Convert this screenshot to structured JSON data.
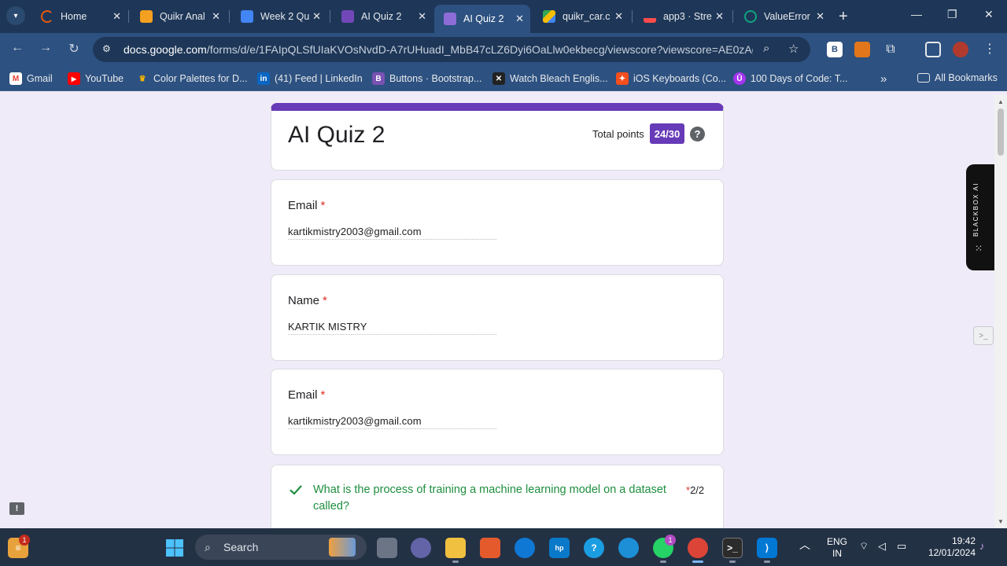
{
  "browser": {
    "tabs": [
      {
        "title": "Home",
        "color": "#e8590c",
        "active": false
      },
      {
        "title": "Quikr Anal",
        "color": "#f4a020",
        "active": false
      },
      {
        "title": "Week 2 Qu",
        "color": "#4285f4",
        "active": false
      },
      {
        "title": "AI Quiz 2",
        "color": "#7248b9",
        "active": false
      },
      {
        "title": "AI Quiz 2",
        "color": "#7248b9",
        "active": true
      },
      {
        "title": "quikr_car.c",
        "color": "#34a853",
        "active": false
      },
      {
        "title": "app3 · Stre",
        "color": "#ff4b4b",
        "active": false
      },
      {
        "title": "ValueError",
        "color": "#10a37f",
        "active": false
      }
    ],
    "url_host": "docs.google.com",
    "url_path": "/forms/d/e/1FAIpQLSfUIaKVOsNvdD-A7rUHuadI_MbB47cLZ6Dyi6OaLlw0ekbecg/viewscore?viewscore=AE0zAg...",
    "bookmarks": [
      {
        "label": "Gmail",
        "icon": "M",
        "color": "#ea4335"
      },
      {
        "label": "YouTube",
        "icon": "▶",
        "color": "#ff0000"
      },
      {
        "label": "Color Palettes for D...",
        "icon": "🏆",
        "color": "#3a3a3a"
      },
      {
        "label": "(41) Feed | LinkedIn",
        "icon": "in",
        "color": "#2d5180"
      },
      {
        "label": "Buttons · Bootstrap...",
        "icon": "B",
        "color": "#7952b3"
      },
      {
        "label": "Watch Bleach Englis...",
        "icon": "✕",
        "color": "#222"
      },
      {
        "label": "iOS Keyboards (Co...",
        "icon": "✦",
        "color": "#a259ff"
      },
      {
        "label": "100 Days of Code: T...",
        "icon": "Ū",
        "color": "#a435f0"
      }
    ],
    "all_bookmarks": "All Bookmarks"
  },
  "form": {
    "title": "AI Quiz 2",
    "total_points_label": "Total points",
    "score": "24/30",
    "help": "?",
    "fields": [
      {
        "label": "Email",
        "required": "*",
        "value": "kartikmistry2003@gmail.com"
      },
      {
        "label": "Name",
        "required": "*",
        "value": "KARTIK MISTRY"
      },
      {
        "label": "Email",
        "required": "*",
        "value": "kartikmistry2003@gmail.com"
      }
    ],
    "question": {
      "text": "What is the process of training a machine learning model on a dataset called?",
      "required": "*",
      "points": "2/2",
      "status": "correct"
    }
  },
  "overlays": {
    "blackbox_label": "BLACKBOX AI"
  },
  "taskbar": {
    "search_placeholder": "Search",
    "lang_top": "ENG",
    "lang_bottom": "IN",
    "time": "19:42",
    "date": "12/01/2024",
    "notification_badge": "1",
    "whatsapp_badge": "1"
  }
}
